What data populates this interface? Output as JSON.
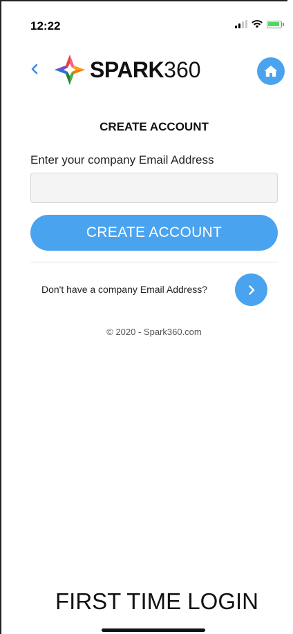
{
  "status_bar": {
    "time": "12:22",
    "icons": [
      "signal-icon",
      "wifi-icon",
      "battery-charging-icon"
    ]
  },
  "header": {
    "back_icon": "chevron-left-icon",
    "logo_bold": "SPARK",
    "logo_light": "360",
    "home_icon": "home-icon"
  },
  "form": {
    "heading": "CREATE ACCOUNT",
    "email_label": "Enter your company Email Address",
    "email_value": "",
    "email_placeholder": "",
    "submit_label": "CREATE ACCOUNT"
  },
  "alternate": {
    "text": "Don't have a company Email Address?",
    "next_icon": "chevron-right-icon"
  },
  "footer": {
    "copyright": "© 2020 - Spark360.com"
  },
  "caption": "FIRST TIME LOGIN",
  "colors": {
    "accent": "#4aa3ee",
    "back_chevron": "#3b8fe0",
    "input_background": "#f4f4f4"
  }
}
